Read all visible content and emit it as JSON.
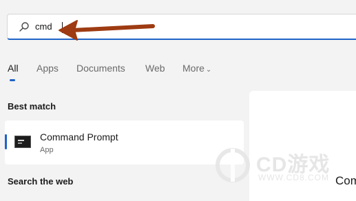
{
  "search": {
    "value": "cmd"
  },
  "tabs": [
    {
      "label": "All",
      "active": true
    },
    {
      "label": "Apps"
    },
    {
      "label": "Documents"
    },
    {
      "label": "Web"
    },
    {
      "label": "More"
    }
  ],
  "sections": {
    "best_match": "Best match",
    "search_web": "Search the web"
  },
  "result": {
    "title": "Command Prompt",
    "subtitle": "App"
  },
  "right_panel": {
    "partial_title": "Com"
  },
  "watermark": {
    "brand": "CD游戏",
    "url": "WWW.CD8.COM"
  },
  "colors": {
    "accent": "#1e63c8",
    "annotation_arrow": "#9e3b12"
  },
  "icons": [
    "search-icon",
    "chevron-down-icon",
    "command-prompt-icon"
  ]
}
